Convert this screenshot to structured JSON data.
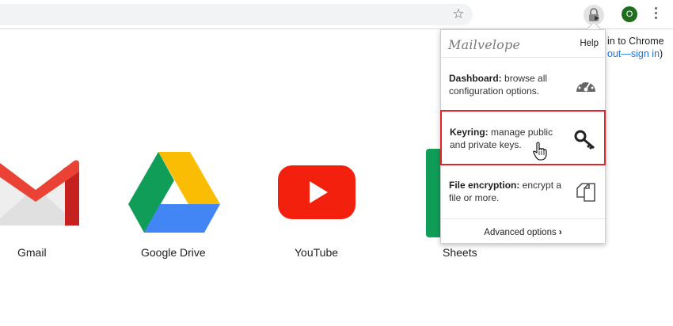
{
  "toolbar": {
    "profile_initial": "O"
  },
  "signin": {
    "line1": "in to Chrome",
    "line2_prefix": "out—",
    "line2_link": "sign in",
    "line2_suffix": ")"
  },
  "apps": [
    {
      "label": "Gmail"
    },
    {
      "label": "Google Drive"
    },
    {
      "label": "YouTube"
    },
    {
      "label": "Sheets"
    }
  ],
  "popup": {
    "brand": "Mailvelope",
    "help": "Help",
    "items": [
      {
        "title": "Dashboard:",
        "desc": " browse all configuration options."
      },
      {
        "title": "Keyring:",
        "desc": " manage public and private keys."
      },
      {
        "title": "File encryption:",
        "desc": " encrypt a file or more."
      }
    ],
    "advanced": "Advanced options"
  },
  "colors": {
    "highlight": "#e0252b",
    "profile_bg": "#1e6e1e",
    "link": "#1a73e8"
  }
}
